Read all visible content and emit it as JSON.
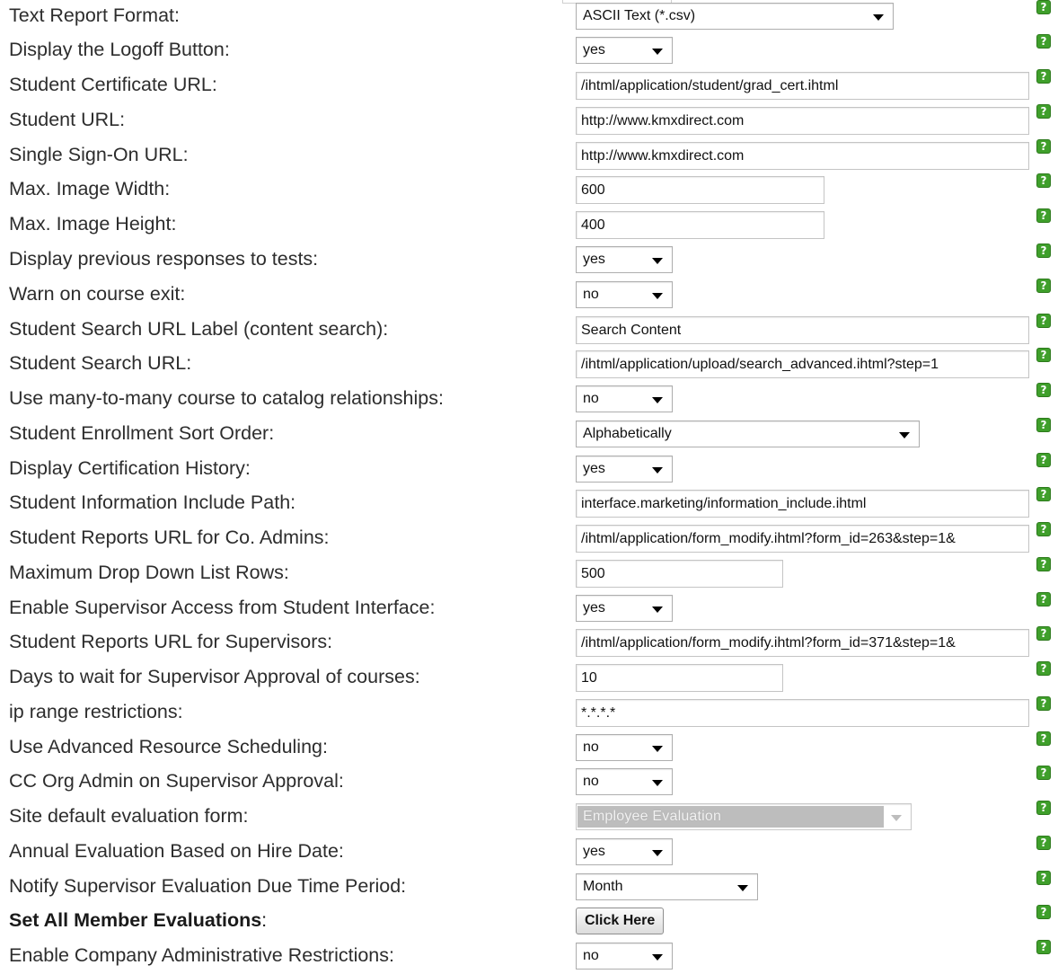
{
  "help_glyph": "?",
  "rows": [
    {
      "label": "Text Report Format:",
      "control": {
        "type": "select",
        "value": "ASCII Text (*.csv)"
      }
    },
    {
      "label": "Display the Logoff Button:",
      "control": {
        "type": "select",
        "value": "yes"
      }
    },
    {
      "label": "Student Certificate URL:",
      "control": {
        "type": "text",
        "value": "/ihtml/application/student/grad_cert.ihtml"
      }
    },
    {
      "label": "Student URL:",
      "control": {
        "type": "text",
        "value": "http://www.kmxdirect.com"
      }
    },
    {
      "label": "Single Sign-On URL:",
      "control": {
        "type": "text",
        "value": "http://www.kmxdirect.com"
      }
    },
    {
      "label": "Max. Image Width:",
      "control": {
        "type": "text",
        "value": "600"
      }
    },
    {
      "label": "Max. Image Height:",
      "control": {
        "type": "text",
        "value": "400"
      }
    },
    {
      "label": "Display previous responses to tests:",
      "control": {
        "type": "select",
        "value": "yes"
      }
    },
    {
      "label": "Warn on course exit:",
      "control": {
        "type": "select",
        "value": "no"
      }
    },
    {
      "label": "Student Search URL Label (content search):",
      "control": {
        "type": "text",
        "value": "Search Content"
      }
    },
    {
      "label": "Student Search URL:",
      "control": {
        "type": "text",
        "value": "/ihtml/application/upload/search_advanced.ihtml?step=1"
      }
    },
    {
      "label": "Use many-to-many course to catalog relationships:",
      "control": {
        "type": "select",
        "value": "no"
      }
    },
    {
      "label": "Student Enrollment Sort Order:",
      "control": {
        "type": "select",
        "value": "Alphabetically"
      }
    },
    {
      "label": "Display Certification History:",
      "control": {
        "type": "select",
        "value": "yes"
      }
    },
    {
      "label": "Student Information Include Path:",
      "control": {
        "type": "text",
        "value": "interface.marketing/information_include.ihtml"
      }
    },
    {
      "label": "Student Reports URL for Co. Admins:",
      "control": {
        "type": "text",
        "value": "/ihtml/application/form_modify.ihtml?form_id=263&step=1&"
      }
    },
    {
      "label": "Maximum Drop Down List Rows:",
      "control": {
        "type": "text",
        "value": "500"
      }
    },
    {
      "label": "Enable Supervisor Access from Student Interface:",
      "control": {
        "type": "select",
        "value": "yes"
      }
    },
    {
      "label": "Student Reports URL for Supervisors:",
      "control": {
        "type": "text",
        "value": "/ihtml/application/form_modify.ihtml?form_id=371&step=1&"
      }
    },
    {
      "label": "Days to wait for Supervisor Approval of courses:",
      "control": {
        "type": "text",
        "value": "10"
      }
    },
    {
      "label": "ip range restrictions:",
      "control": {
        "type": "text",
        "value": "*.*.*.*"
      }
    },
    {
      "label": "Use Advanced Resource Scheduling:",
      "control": {
        "type": "select",
        "value": "no"
      }
    },
    {
      "label": "CC Org Admin on Supervisor Approval:",
      "control": {
        "type": "select",
        "value": "no"
      }
    },
    {
      "label": "Site default evaluation form:",
      "control": {
        "type": "select",
        "value": "Employee Evaluation",
        "disabled": true
      }
    },
    {
      "label": "Annual Evaluation Based on Hire Date:",
      "control": {
        "type": "select",
        "value": "yes"
      }
    },
    {
      "label": "Notify Supervisor Evaluation Due Time Period:",
      "control": {
        "type": "select",
        "value": "Month"
      }
    },
    {
      "label": "Set All Member Evaluations",
      "label_suffix": ":",
      "bold": true,
      "control": {
        "type": "button",
        "value": "Click Here"
      }
    },
    {
      "label": "Enable Company Administrative Restrictions:",
      "control": {
        "type": "select",
        "value": "no"
      }
    }
  ]
}
